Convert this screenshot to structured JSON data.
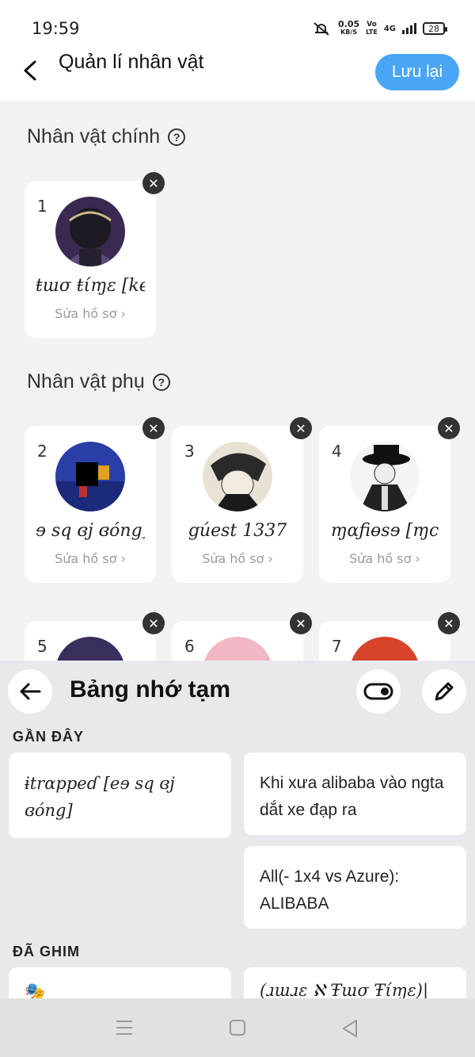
{
  "status_bar": {
    "time": "19:59",
    "speed": "0.05",
    "speed_unit": "KB/S",
    "volte": "Vo",
    "volte2": "LTE",
    "network": "4G",
    "battery": "28"
  },
  "header": {
    "title": "Quản lí nhân vật",
    "save_label": "Lưu lại"
  },
  "main_characters": {
    "title": "Nhân vật chính",
    "help": "?",
    "items": [
      {
        "num": "1",
        "name": "ŧɯσ ŧίɱɛ [ke",
        "edit": "Sửa hồ sơ ›"
      }
    ]
  },
  "side_characters": {
    "title": "Nhân vật phụ",
    "help": "?",
    "items": [
      {
        "num": "2",
        "name": "ɘ sq ɞj ɞóng]",
        "edit": "Sửa hồ sơ ›"
      },
      {
        "num": "3",
        "name": "ցúest 1337",
        "edit": "Sửa hồ sơ ›"
      },
      {
        "num": "4",
        "name": "ɱɑƒiɵsɘ [ɱc",
        "edit": "Sửa hồ sơ ›"
      },
      {
        "num": "5"
      },
      {
        "num": "6"
      },
      {
        "num": "7"
      }
    ]
  },
  "clipboard": {
    "title": "Bảng nhớ tạm",
    "recent_label": "GẦN ĐÂY",
    "pinned_label": "ĐÃ GHIM",
    "recent": [
      "ɨtrɑppeɗ [eɘ sq ɞj ɞóng]",
      "Khi xưa alibaba vào ngta dắt xe đạp ra",
      "All(- 1x4 vs Azure): ALIBABA"
    ],
    "pinned": [
      "🎭",
      "(ɹɯɹɛ ℵ Ŧɯσ Ŧίɱɛ)|"
    ]
  },
  "colors": {
    "accent": "#4aa6f5",
    "panel": "#e8e9ed",
    "background": "#f2f2f2"
  }
}
